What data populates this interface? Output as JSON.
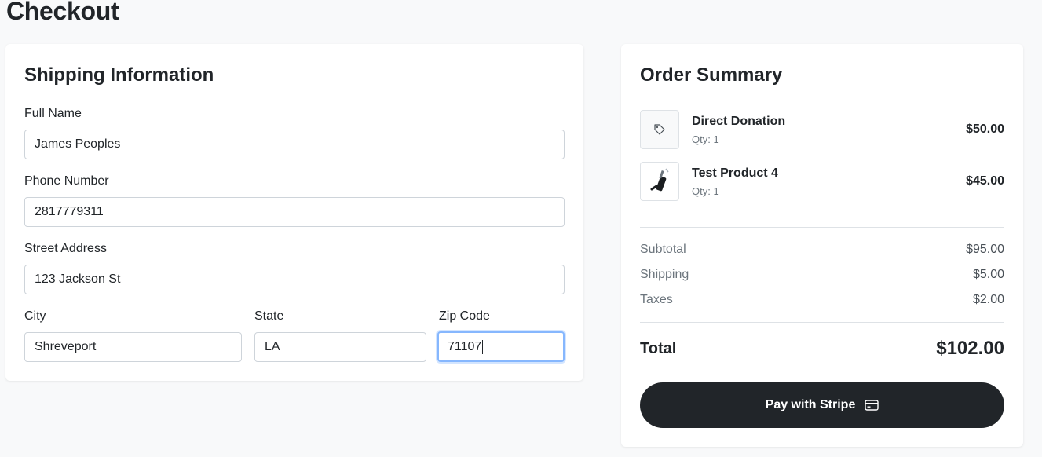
{
  "page": {
    "title": "Checkout"
  },
  "shipping": {
    "title": "Shipping Information",
    "full_name": {
      "label": "Full Name",
      "value": "James Peoples"
    },
    "phone": {
      "label": "Phone Number",
      "value": "2817779311"
    },
    "street": {
      "label": "Street Address",
      "value": "123 Jackson St"
    },
    "city": {
      "label": "City",
      "value": "Shreveport"
    },
    "state": {
      "label": "State",
      "value": "LA"
    },
    "zip": {
      "label": "Zip Code",
      "value": "71107"
    }
  },
  "summary": {
    "title": "Order Summary",
    "items": [
      {
        "name": "Direct Donation",
        "qty": "Qty: 1",
        "price": "$50.00",
        "icon": "tag-icon"
      },
      {
        "name": "Test Product 4",
        "qty": "Qty: 1",
        "price": "$45.00",
        "icon": "product-image"
      }
    ],
    "subtotal": {
      "label": "Subtotal",
      "value": "$95.00"
    },
    "shipping": {
      "label": "Shipping",
      "value": "$5.00"
    },
    "taxes": {
      "label": "Taxes",
      "value": "$2.00"
    },
    "total": {
      "label": "Total",
      "value": "$102.00"
    },
    "pay_button": {
      "label": "Pay with Stripe",
      "icon": "credit-card-icon"
    }
  },
  "colors": {
    "background": "#f8f9fa",
    "primary_dark": "#212529",
    "focus_ring": "#86b7fe",
    "muted_text": "#6c757d"
  }
}
